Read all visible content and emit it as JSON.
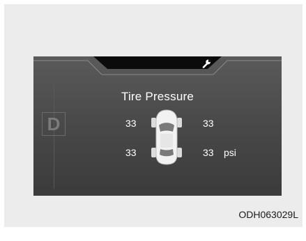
{
  "display": {
    "title": "Tire Pressure",
    "gear": "D",
    "unit": "psi",
    "tires": {
      "front_left": "33",
      "front_right": "33",
      "rear_left": "33",
      "rear_right": "33"
    }
  },
  "icons": {
    "header": "wrench-icon",
    "vehicle": "car-top-view-icon"
  },
  "figure_code": "ODH063029L",
  "colors": {
    "screen": "#4a4a4a",
    "text": "#ffffff",
    "frame": "#ececec"
  }
}
